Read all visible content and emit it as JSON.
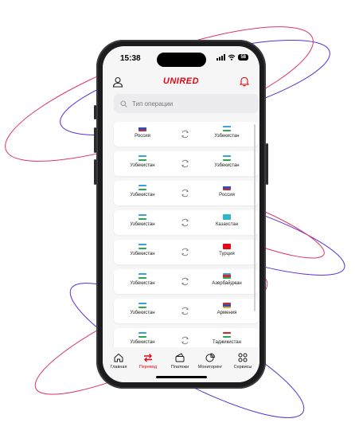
{
  "status_bar": {
    "time": "15:38",
    "signal_icon": "signal-icon",
    "wifi_icon": "wifi-icon",
    "battery": "58"
  },
  "header": {
    "brand": "UNIRED",
    "brand_color": "#e30613",
    "left_icon": "user-icon",
    "right_icon": "bell-icon"
  },
  "search": {
    "placeholder": "Тип операции",
    "icon": "search-icon"
  },
  "routes": [
    {
      "from": "Россия",
      "from_flag": "flag-russia",
      "to": "Узбекистан",
      "to_flag": "flag-uzbekistan"
    },
    {
      "from": "Узбекистан",
      "from_flag": "flag-uzbekistan",
      "to": "Узбекистан",
      "to_flag": "flag-uzbekistan"
    },
    {
      "from": "Узбекистан",
      "from_flag": "flag-uzbekistan",
      "to": "Россия",
      "to_flag": "flag-russia"
    },
    {
      "from": "Узбекистан",
      "from_flag": "flag-uzbekistan",
      "to": "Казахстан",
      "to_flag": "flag-kazakhstan"
    },
    {
      "from": "Узбекистан",
      "from_flag": "flag-uzbekistan",
      "to": "Турция",
      "to_flag": "flag-turkey"
    },
    {
      "from": "Узбекистан",
      "from_flag": "flag-uzbekistan",
      "to": "Азербайджан",
      "to_flag": "flag-azerbaijan"
    },
    {
      "from": "Узбекистан",
      "from_flag": "flag-uzbekistan",
      "to": "Армения",
      "to_flag": "flag-armenia"
    },
    {
      "from": "Узбекистан",
      "from_flag": "flag-uzbekistan",
      "to": "Таджикистан",
      "to_flag": "flag-tajikistan"
    }
  ],
  "tabs": [
    {
      "label": "Главная",
      "icon": "home-icon",
      "active": false
    },
    {
      "label": "Перевод",
      "icon": "transfer-icon",
      "active": true
    },
    {
      "label": "Платежи",
      "icon": "wallet-icon",
      "active": false
    },
    {
      "label": "Мониторинг",
      "icon": "pie-chart-icon",
      "active": false
    },
    {
      "label": "Сервисы",
      "icon": "grid-icon",
      "active": false
    }
  ],
  "colors": {
    "accent": "#e30613",
    "decor_red": "#e0336a",
    "decor_purple": "#5a2fd6"
  }
}
